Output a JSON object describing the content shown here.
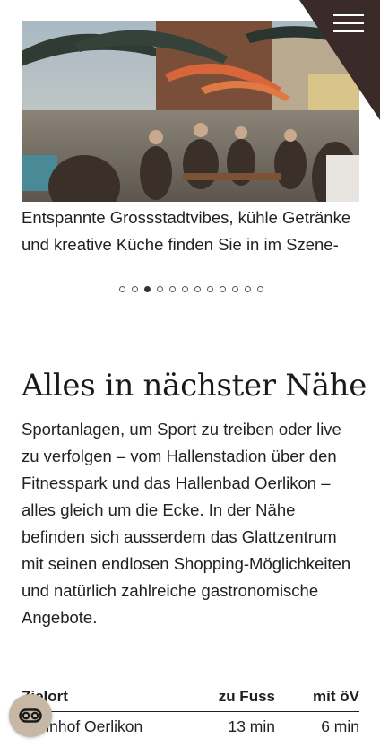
{
  "hero": {
    "caption": "Entspannte Grossstadtvibes, kühle Getränke und kreative Küche finden Sie in im Szene-"
  },
  "carousel": {
    "count": 12,
    "active_index": 2
  },
  "section": {
    "heading": "Alles in nächster Nähe",
    "body": "Sportanlagen, um Sport zu treiben oder live zu verfolgen – vom Hallenstadion über den Fitnesspark und das Hallenbad Oerlikon – alles gleich um die Ecke. In der Nähe befinden sich ausserdem das Glattzentrum mit seinen endlosen Shopping-Möglichkeiten und natürlich zahlreiche gastronomische Angebote."
  },
  "table": {
    "headers": {
      "destination": "Zielort",
      "walk": "zu Fuss",
      "transit": "mit öV"
    },
    "rows": [
      {
        "destination": "Bahnhof Oerlikon",
        "walk": "13 min",
        "transit": "6 min"
      }
    ]
  },
  "colors": {
    "corner": "#3a2a28",
    "cookie": "#c7b8a5",
    "text": "#1f1f1f"
  },
  "icons": {
    "menu": "hamburger-icon",
    "cookie": "cookie-settings-icon"
  }
}
